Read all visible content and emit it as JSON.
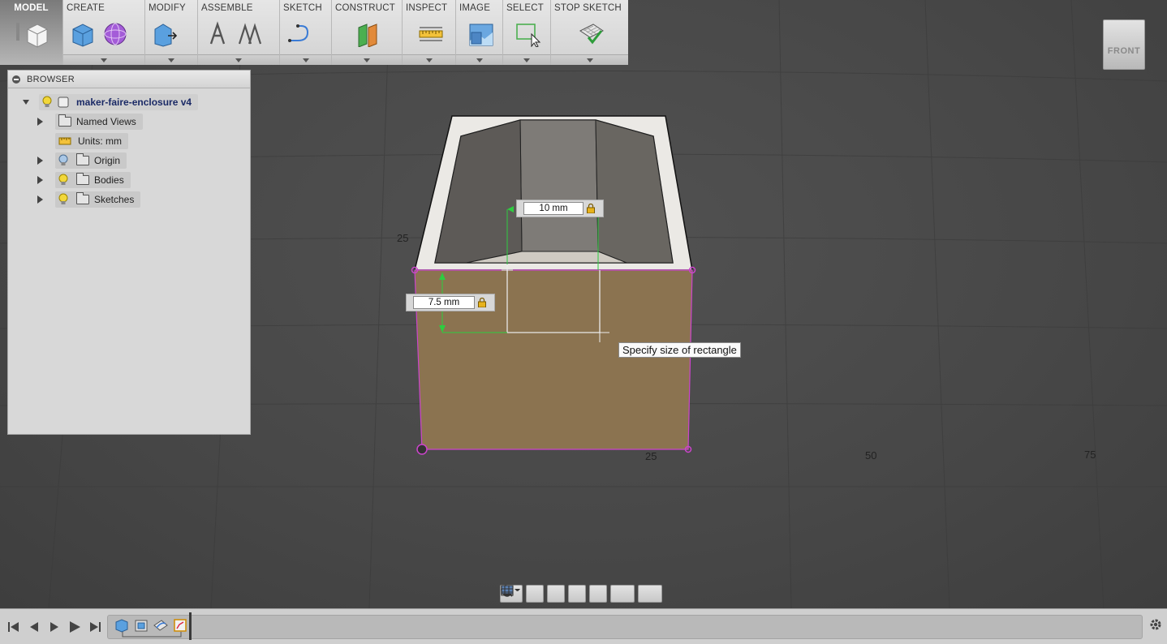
{
  "toolbar": {
    "model": "MODEL",
    "create": "CREATE",
    "modify": "MODIFY",
    "assemble": "ASSEMBLE",
    "sketch": "SKETCH",
    "construct": "CONSTRUCT",
    "inspect": "INSPECT",
    "image": "IMAGE",
    "select": "SELECT",
    "stop_sketch": "STOP SKETCH"
  },
  "browser": {
    "title": "BROWSER",
    "root": "maker-faire-enclosure v4",
    "items": [
      {
        "label": "Named Views",
        "icon": "folder-icon"
      },
      {
        "label": "Units: mm",
        "icon": "ruler-icon"
      },
      {
        "label": "Origin",
        "icon": "folder-icon"
      },
      {
        "label": "Bodies",
        "icon": "folder-icon"
      },
      {
        "label": "Sketches",
        "icon": "folder-icon"
      }
    ]
  },
  "viewport": {
    "dim_width": "10 mm",
    "dim_height": "7.5 mm",
    "tooltip": "Specify size of rectangle",
    "grid_labels": {
      "y25": "25",
      "x25": "25",
      "x50": "50",
      "x75": "75"
    }
  },
  "viewcube": {
    "face": "FRONT"
  },
  "colors": {
    "sketch_profile": "#8b7350",
    "sketch_line": "#cc44cc",
    "dimension_green": "#2ecc40"
  }
}
